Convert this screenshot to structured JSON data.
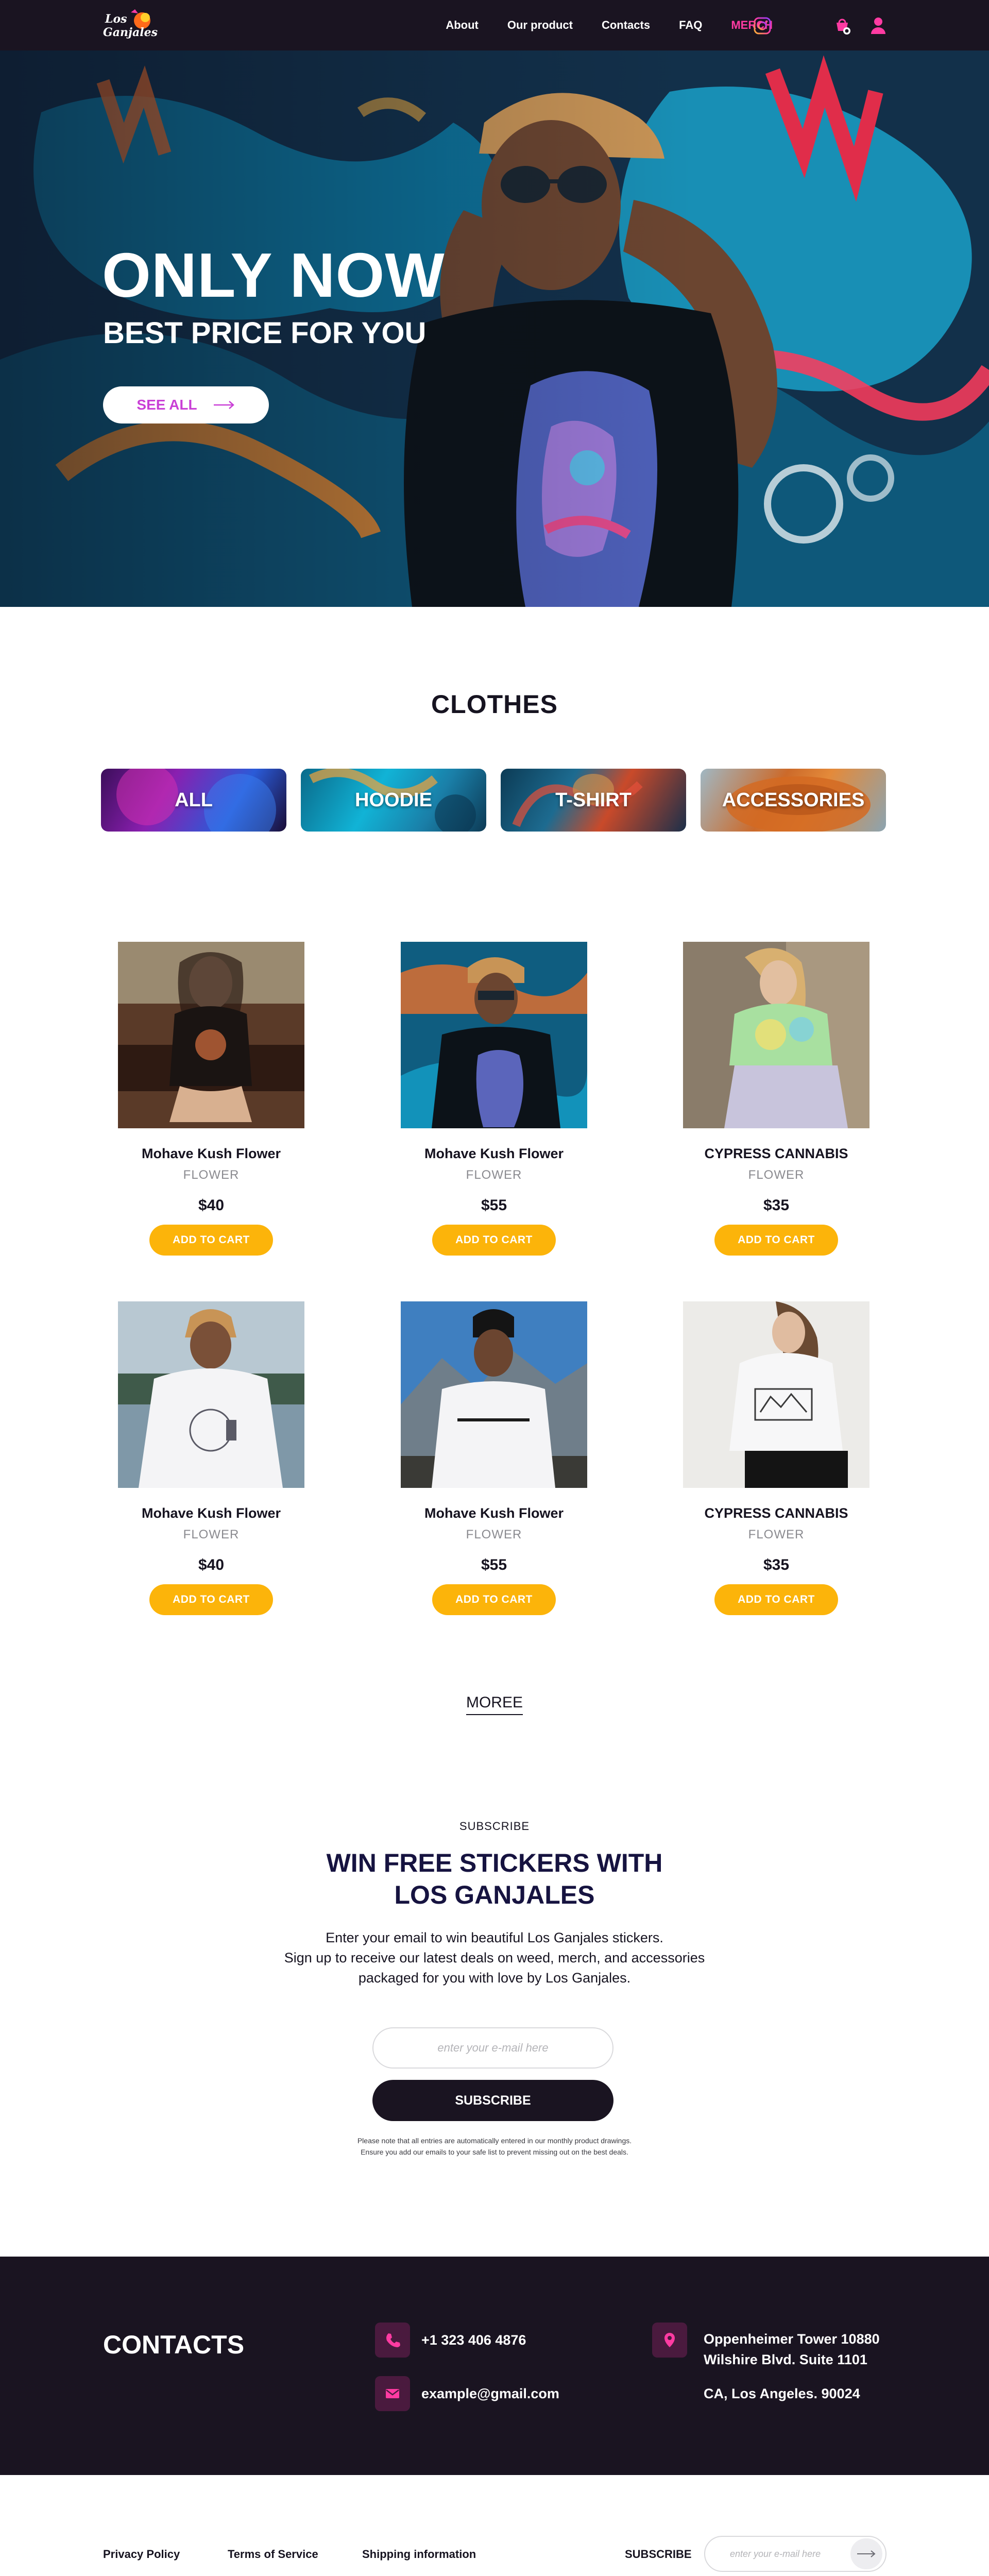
{
  "nav": {
    "links": [
      "About",
      "Our product",
      "Contacts",
      "FAQ",
      "MERCH"
    ],
    "logo_text": "Los Ganjales",
    "accent": "#ff3ba2"
  },
  "hero": {
    "title": "ONLY NOW",
    "subtitle": "BEST PRICE FOR YOU",
    "button_label": "SEE ALL"
  },
  "clothes": {
    "title": "CLOTHES",
    "categories": [
      "ALL",
      "HOODIE",
      "T-SHIRT",
      "ACCESSORIES"
    ]
  },
  "products": [
    {
      "name": "Mohave Kush Flower",
      "category": "FLOWER",
      "price": "$40",
      "button": "ADD TO CART"
    },
    {
      "name": "Mohave Kush Flower",
      "category": "FLOWER",
      "price": "$55",
      "button": "ADD TO CART"
    },
    {
      "name": "CYPRESS CANNABIS",
      "category": "FLOWER",
      "price": "$35",
      "button": "ADD TO CART"
    },
    {
      "name": "Mohave Kush Flower",
      "category": "FLOWER",
      "price": "$40",
      "button": "ADD TO CART"
    },
    {
      "name": "Mohave Kush Flower",
      "category": "FLOWER",
      "price": "$55",
      "button": "ADD TO CART"
    },
    {
      "name": "CYPRESS CANNABIS",
      "category": "FLOWER",
      "price": "$35",
      "button": "ADD TO CART"
    }
  ],
  "more_label": "MOREE",
  "subscribe": {
    "kicker": "SUBSCRIBE",
    "title_line1": "WIN FREE STICKERS WITH",
    "title_line2": "LOS GANJALES",
    "desc_line1": "Enter your email to win beautiful Los Ganjales stickers.",
    "desc_line2": "Sign up to receive our latest deals on weed, merch, and accessories",
    "desc_line3": "packaged for you with love by Los Ganjales.",
    "placeholder": "enter your e-mail here",
    "button_label": "SUBSCRIBE",
    "note_line1": "Please note that all entries are automatically entered in our monthly product drawings.",
    "note_line2": "Ensure you add our emails to your safe list to prevent missing out on the best deals."
  },
  "contacts": {
    "title": "CONTACTS",
    "phone": "+1 323 406 4876",
    "email": "example@gmail.com",
    "address_line1": "Oppenheimer Tower 10880",
    "address_line2": "Wilshire Blvd. Suite 1101",
    "address_line3": "CA, Los Angeles. 90024"
  },
  "footer": {
    "links": [
      "Privacy Policy",
      "Terms of Service",
      "Shipping information"
    ],
    "subscribe_label": "SUBSCRIBE",
    "placeholder": "enter your e-mail here"
  }
}
